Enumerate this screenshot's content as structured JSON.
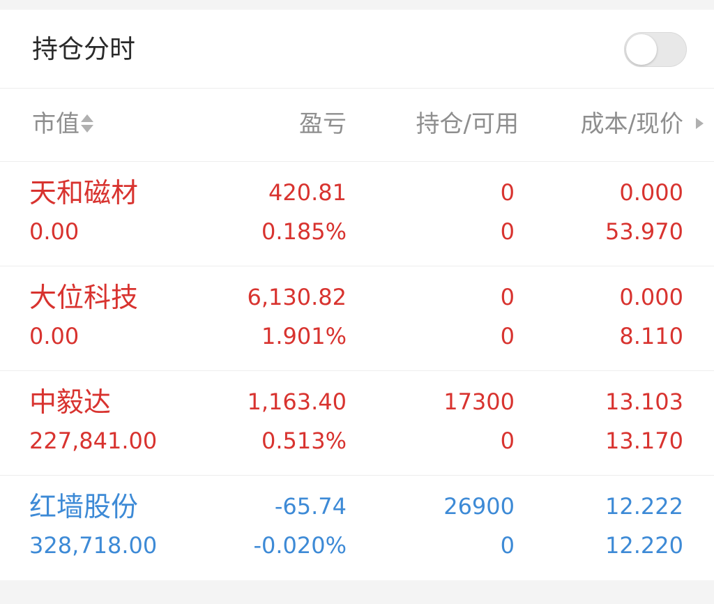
{
  "toggle": {
    "label": "持仓分时",
    "on": false
  },
  "header": {
    "market_value": "市值",
    "profit_loss": "盈亏",
    "position_available": "持仓/可用",
    "cost_price": "成本/现价"
  },
  "colors": {
    "gain": "#d8332f",
    "loss": "#3d8ad6",
    "header_text": "#8e8e8e"
  },
  "rows": [
    {
      "name": "天和磁材",
      "market_value": "0.00",
      "profit": "420.81",
      "profit_pct": "0.185%",
      "position": "0",
      "available": "0",
      "cost": "0.000",
      "price": "53.970"
    },
    {
      "name": "大位科技",
      "market_value": "0.00",
      "profit": "6,130.82",
      "profit_pct": "1.901%",
      "position": "0",
      "available": "0",
      "cost": "0.000",
      "price": "8.110"
    },
    {
      "name": "中毅达",
      "market_value": "227,841.00",
      "profit": "1,163.40",
      "profit_pct": "0.513%",
      "position": "17300",
      "available": "0",
      "cost": "13.103",
      "price": "13.170"
    },
    {
      "name": "红墙股份",
      "market_value": "328,718.00",
      "profit": "-65.74",
      "profit_pct": "-0.020%",
      "position": "26900",
      "available": "0",
      "cost": "12.222",
      "price": "12.220"
    }
  ]
}
